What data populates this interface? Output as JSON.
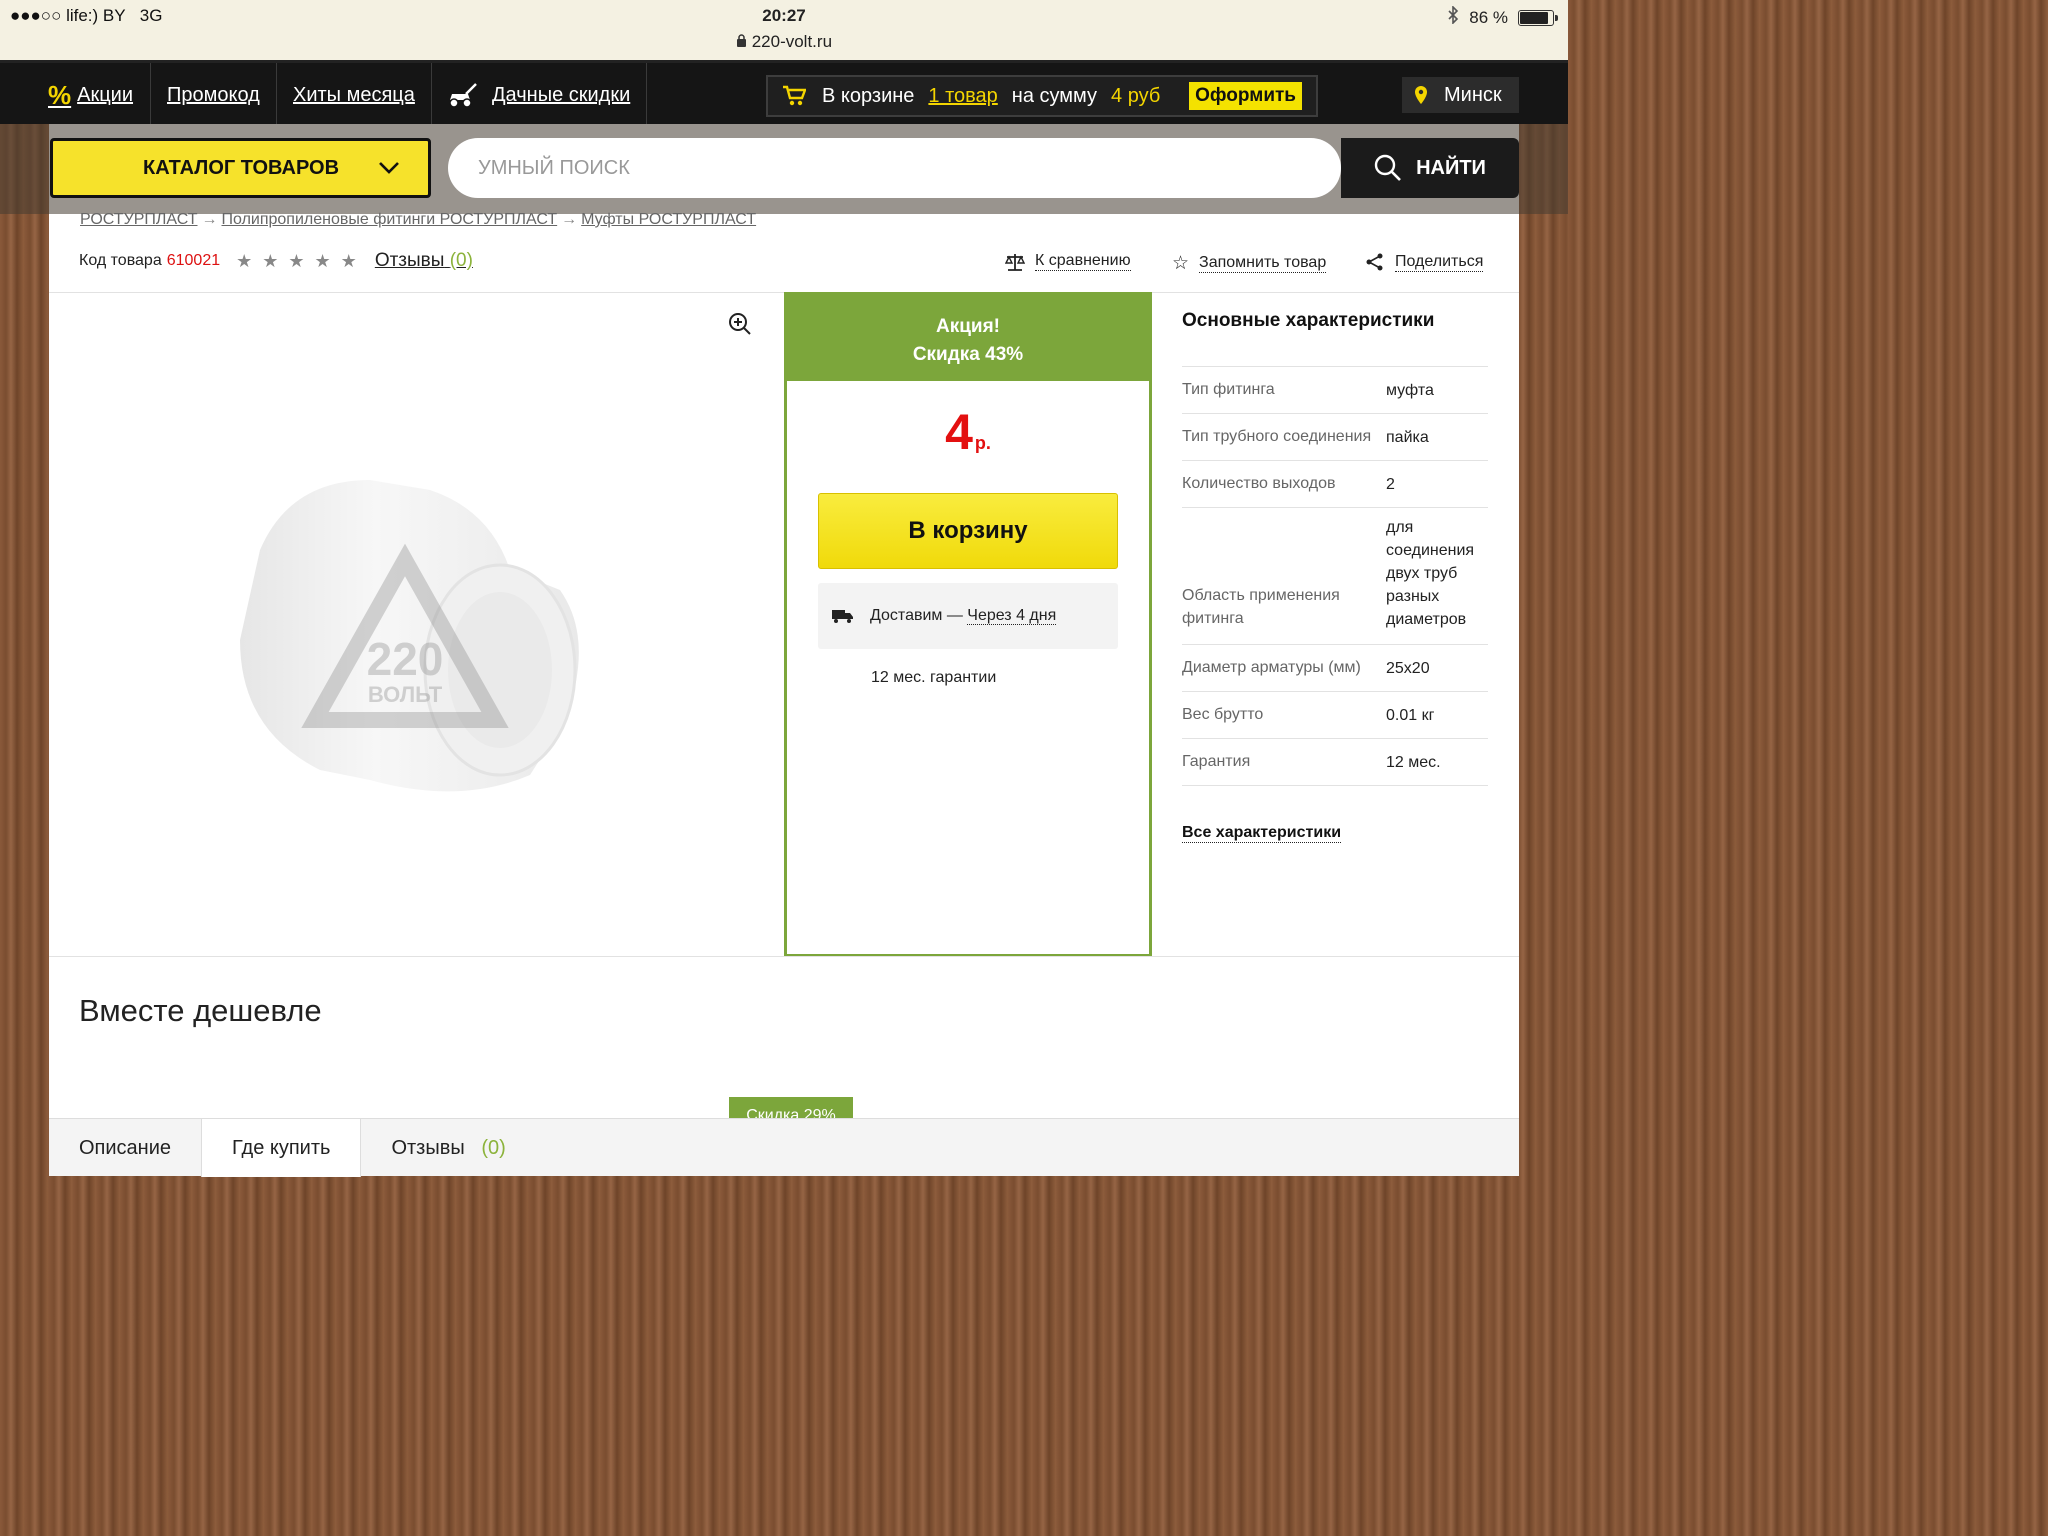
{
  "status": {
    "carrier": "●●●○○ life:) BY",
    "network": "3G",
    "time": "20:27",
    "url": "220-volt.ru",
    "battery": "86 %",
    "battery_level": 0.86
  },
  "nav": {
    "promo_symbol": "%",
    "items": [
      "Акции",
      "Промокод",
      "Хиты месяца",
      "Дачные скидки"
    ],
    "cart": {
      "prefix": "В корзине",
      "count": "1 товар",
      "middle": "на сумму",
      "sum": "4 руб",
      "checkout": "Оформить"
    },
    "city": "Минск"
  },
  "search": {
    "catalog_label": "КАТАЛОГ ТОВАРОВ",
    "placeholder": "УМНЫЙ ПОИСК",
    "button": "НАЙТИ"
  },
  "breadcrumbs": [
    "РОСТУРПЛАСТ",
    "Полипропиленовые фитинги РОСТУРПЛАСТ",
    "Муфты РОСТУРПЛАСТ"
  ],
  "product": {
    "code_label": "Код товара",
    "code": "610021",
    "rating": 0,
    "reviews_label": "Отзывы",
    "reviews_count": "(0)",
    "compare": "К сравнению",
    "remember": "Запомнить товар",
    "share": "Поделиться",
    "watermark": "220 ВОЛЬТ"
  },
  "offer": {
    "promo_line1": "Акция!",
    "promo_line2": "Скидка 43%",
    "price": "4",
    "currency": "р.",
    "cart_button": "В корзину",
    "delivery_label": "Доставим —",
    "delivery_when": "Через 4 дня",
    "warranty": "12 мес. гарантии"
  },
  "specs": {
    "title": "Основные характеристики",
    "rows": [
      {
        "k": "Тип фитинга",
        "v": "муфта"
      },
      {
        "k": "Тип трубного соединения",
        "v": "пайка"
      },
      {
        "k": "Количество выходов",
        "v": "2"
      },
      {
        "k": "Область применения фитинга",
        "v": "для соединения двух труб разных диаметров"
      },
      {
        "k": "Диаметр арматуры (мм)",
        "v": "25x20"
      },
      {
        "k": "Вес брутто",
        "v": "0.01 кг"
      },
      {
        "k": "Гарантия",
        "v": "12 мес."
      }
    ],
    "all_link": "Все характеристики"
  },
  "together": {
    "title": "Вместе дешевле",
    "badge": "Скидка 29%"
  },
  "tabs": {
    "description": "Описание",
    "where_buy": "Где купить",
    "reviews": "Отзывы",
    "reviews_count": "(0)"
  },
  "colors": {
    "accent_yellow": "#f6e22b",
    "promo_green": "#7ca63b",
    "price_red": "#e31010"
  }
}
